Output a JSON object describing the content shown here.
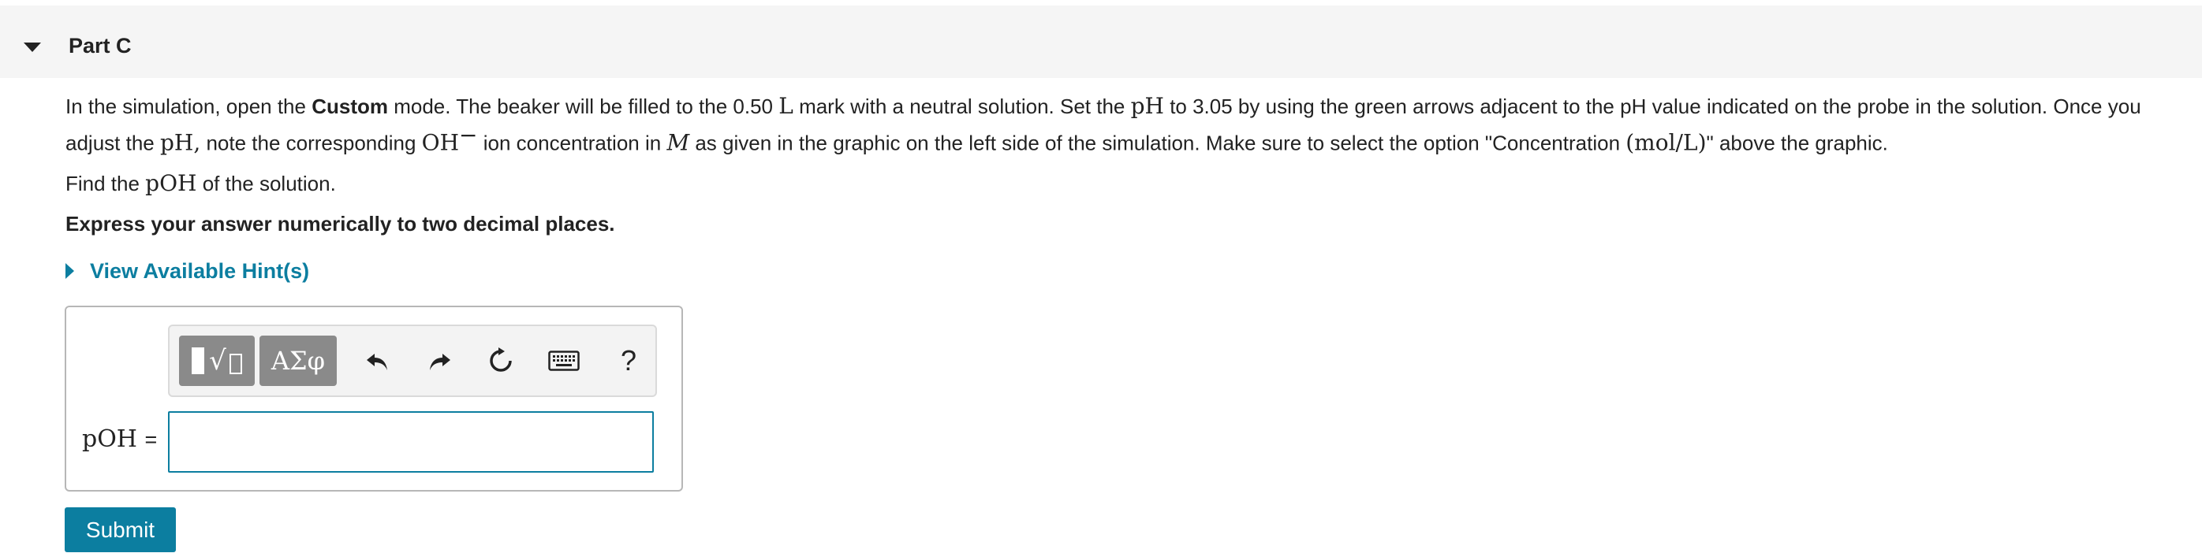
{
  "part": {
    "title": "Part C"
  },
  "question": {
    "p1_a": "In the simulation, open the ",
    "p1_custom": "Custom",
    "p1_b": " mode. The beaker will be filled to the 0.50 ",
    "p1_L": "L",
    "p1_c": " mark with a neutral solution. Set the ",
    "p1_pH": "pH",
    "p1_d": " to 3.05 by using the green arrows adjacent to the pH value indicated on the probe in the solution. Once you",
    "p2_a": "adjust the ",
    "p2_pH": "pH,",
    "p2_b": " note the corresponding ",
    "p2_OH": "OH",
    "p2_minus": "−",
    "p2_c": " ion concentration in ",
    "p2_M": "M",
    "p2_d": " as given in the graphic on the left side of the simulation. Make sure to select the option \"Concentration ",
    "p2_unit": "(mol/L)",
    "p2_e": "\" above the graphic.",
    "find_a": "Find the ",
    "find_pOH": "pOH",
    "find_b": " of the solution.",
    "express": "Express your answer numerically to two decimal places."
  },
  "hints": {
    "label": "View Available Hint(s)"
  },
  "toolbar": {
    "templates_icon": "templates-icon",
    "symbols_label": "ΑΣφ",
    "undo_icon": "undo-icon",
    "redo_icon": "redo-icon",
    "reset_icon": "reset-icon",
    "keyboard_icon": "keyboard-icon",
    "help_label": "?"
  },
  "answer": {
    "variable": "pOH",
    "equals": "=",
    "value": ""
  },
  "submit": {
    "label": "Submit"
  },
  "colors": {
    "accent": "#0c7ea0",
    "toolbar_button": "#8a8a8a",
    "header_bg": "#f5f5f5"
  }
}
